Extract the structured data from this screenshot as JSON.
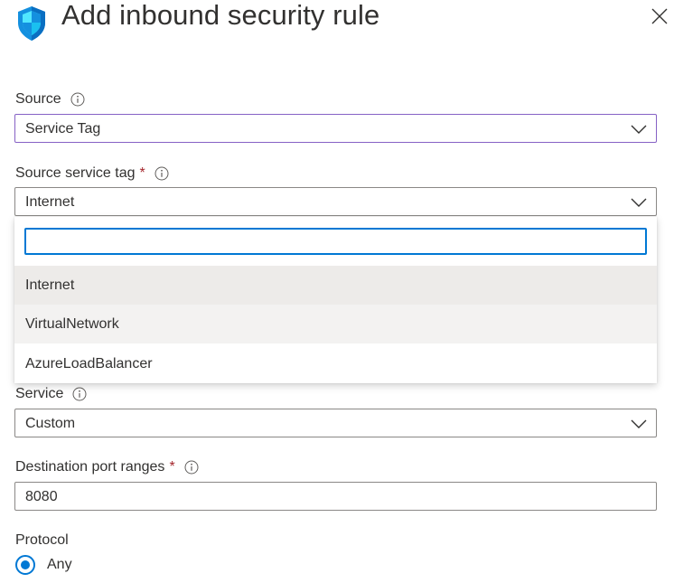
{
  "header": {
    "title": "Add inbound security rule",
    "icon": "shield-icon",
    "close_icon": "close-icon"
  },
  "source": {
    "label": "Source",
    "value": "Service Tag"
  },
  "source_service_tag": {
    "label": "Source service tag",
    "required_marker": "*",
    "value": "Internet",
    "filter_value": "",
    "options": [
      "Internet",
      "VirtualNetwork",
      "AzureLoadBalancer"
    ]
  },
  "service": {
    "label": "Service",
    "value": "Custom"
  },
  "destination_port_ranges": {
    "label": "Destination port ranges",
    "required_marker": "*",
    "value": "8080"
  },
  "protocol": {
    "label": "Protocol",
    "selected_option": "Any"
  },
  "colors": {
    "accent": "#0078d4",
    "required": "#a4262c",
    "focus_border": "#8661c5",
    "shield_light": "#50e6ff",
    "shield_dark": "#1490df"
  }
}
